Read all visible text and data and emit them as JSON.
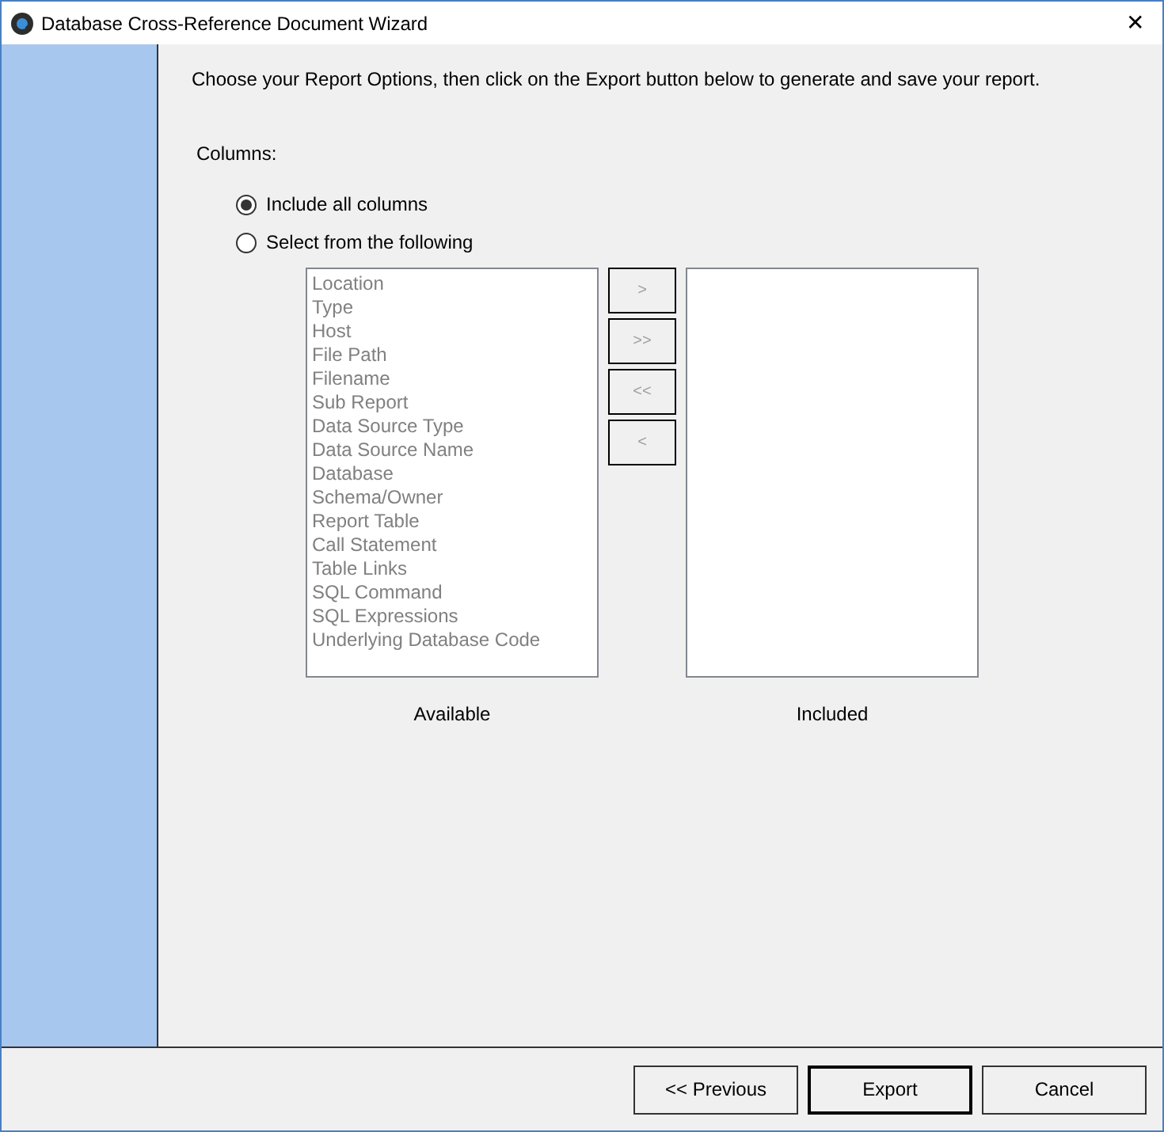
{
  "window": {
    "title": "Database Cross-Reference Document Wizard",
    "close": "✕"
  },
  "instructions": "Choose your Report Options, then click on the Export button below to generate and save your report.",
  "columns": {
    "label": "Columns:",
    "options": [
      {
        "label": "Include all columns",
        "selected": true
      },
      {
        "label": "Select from the following",
        "selected": false
      }
    ],
    "available": {
      "caption": "Available",
      "disabled": true,
      "items": [
        "Location",
        "Type",
        "Host",
        "File Path",
        "Filename",
        "Sub Report",
        "Data Source Type",
        "Data Source Name",
        "Database",
        "Schema/Owner",
        "Report Table",
        "Call Statement",
        "Table Links",
        "SQL Command",
        "SQL Expressions",
        "Underlying Database Code"
      ]
    },
    "transfer_buttons": [
      {
        "label": ">",
        "disabled": true
      },
      {
        "label": ">>",
        "disabled": true
      },
      {
        "label": "<<",
        "disabled": true
      },
      {
        "label": "<",
        "disabled": true
      }
    ],
    "included": {
      "caption": "Included"
    }
  },
  "buttons": [
    {
      "label": "<< Previous",
      "default": false
    },
    {
      "label": "Export",
      "default": true
    },
    {
      "label": "Cancel",
      "default": false
    }
  ]
}
